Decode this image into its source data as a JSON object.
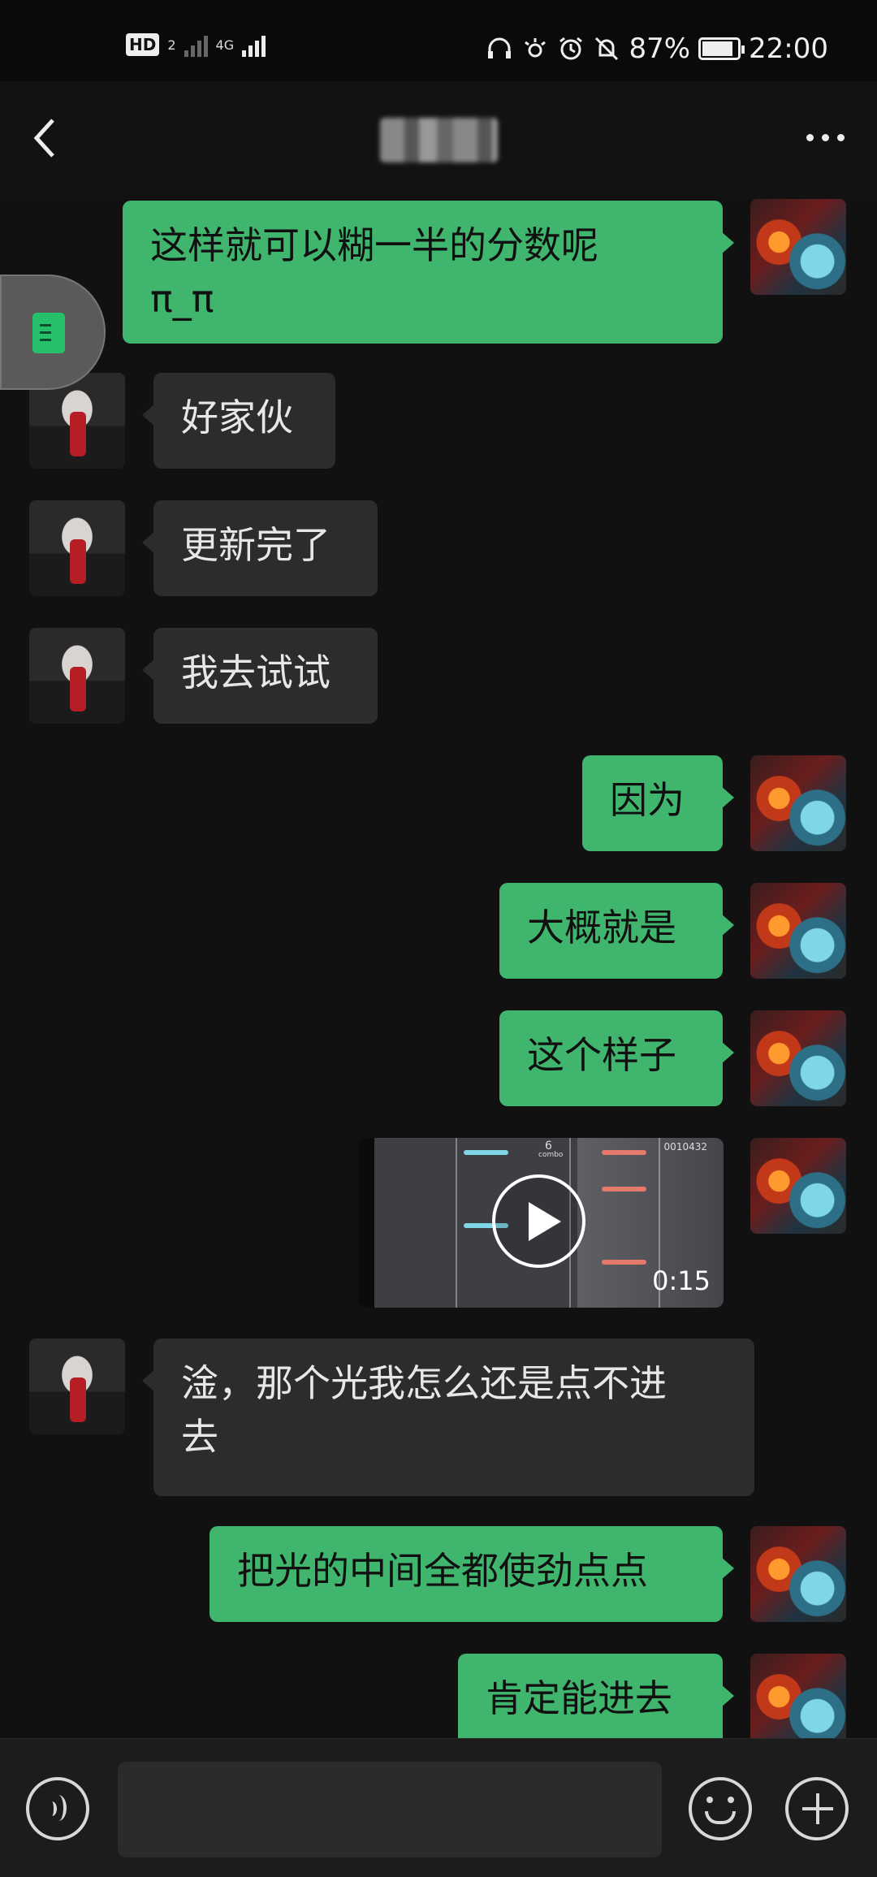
{
  "status_bar": {
    "hd_label": "HD",
    "hd_sub": "2",
    "network_label": "4G",
    "battery_text": "87%",
    "battery_level": 0.87,
    "time": "22:00"
  },
  "header": {
    "back_icon": "chevron-left-icon",
    "more_icon": "ellipsis-icon"
  },
  "messages": [
    {
      "sender": "me",
      "text": "这样就可以糊一半的分数呢\nπ_π"
    },
    {
      "sender": "other",
      "text": "好家伙"
    },
    {
      "sender": "other",
      "text": "更新完了"
    },
    {
      "sender": "other",
      "text": "我去试试"
    },
    {
      "sender": "me",
      "text": "因为"
    },
    {
      "sender": "me",
      "text": "大概就是"
    },
    {
      "sender": "me",
      "text": "这个样子"
    },
    {
      "sender": "me",
      "type": "video",
      "duration": "0:15",
      "overlay_combo": "6",
      "overlay_combo_label": "combo",
      "overlay_score": "0010432"
    },
    {
      "sender": "other",
      "text": "淦，那个光我怎么还是点不进\n去"
    },
    {
      "sender": "me",
      "text": "把光的中间全都使劲点点"
    },
    {
      "sender": "me",
      "text": "肯定能进去"
    }
  ],
  "input_bar": {
    "voice_icon": "voice-icon",
    "emoji_icon": "emoji-icon",
    "plus_icon": "plus-icon",
    "message_value": ""
  },
  "colors": {
    "background": "#111111",
    "my_bubble": "#3fb56d",
    "other_bubble": "#2c2c2c",
    "float_doc": "#27c06a"
  }
}
